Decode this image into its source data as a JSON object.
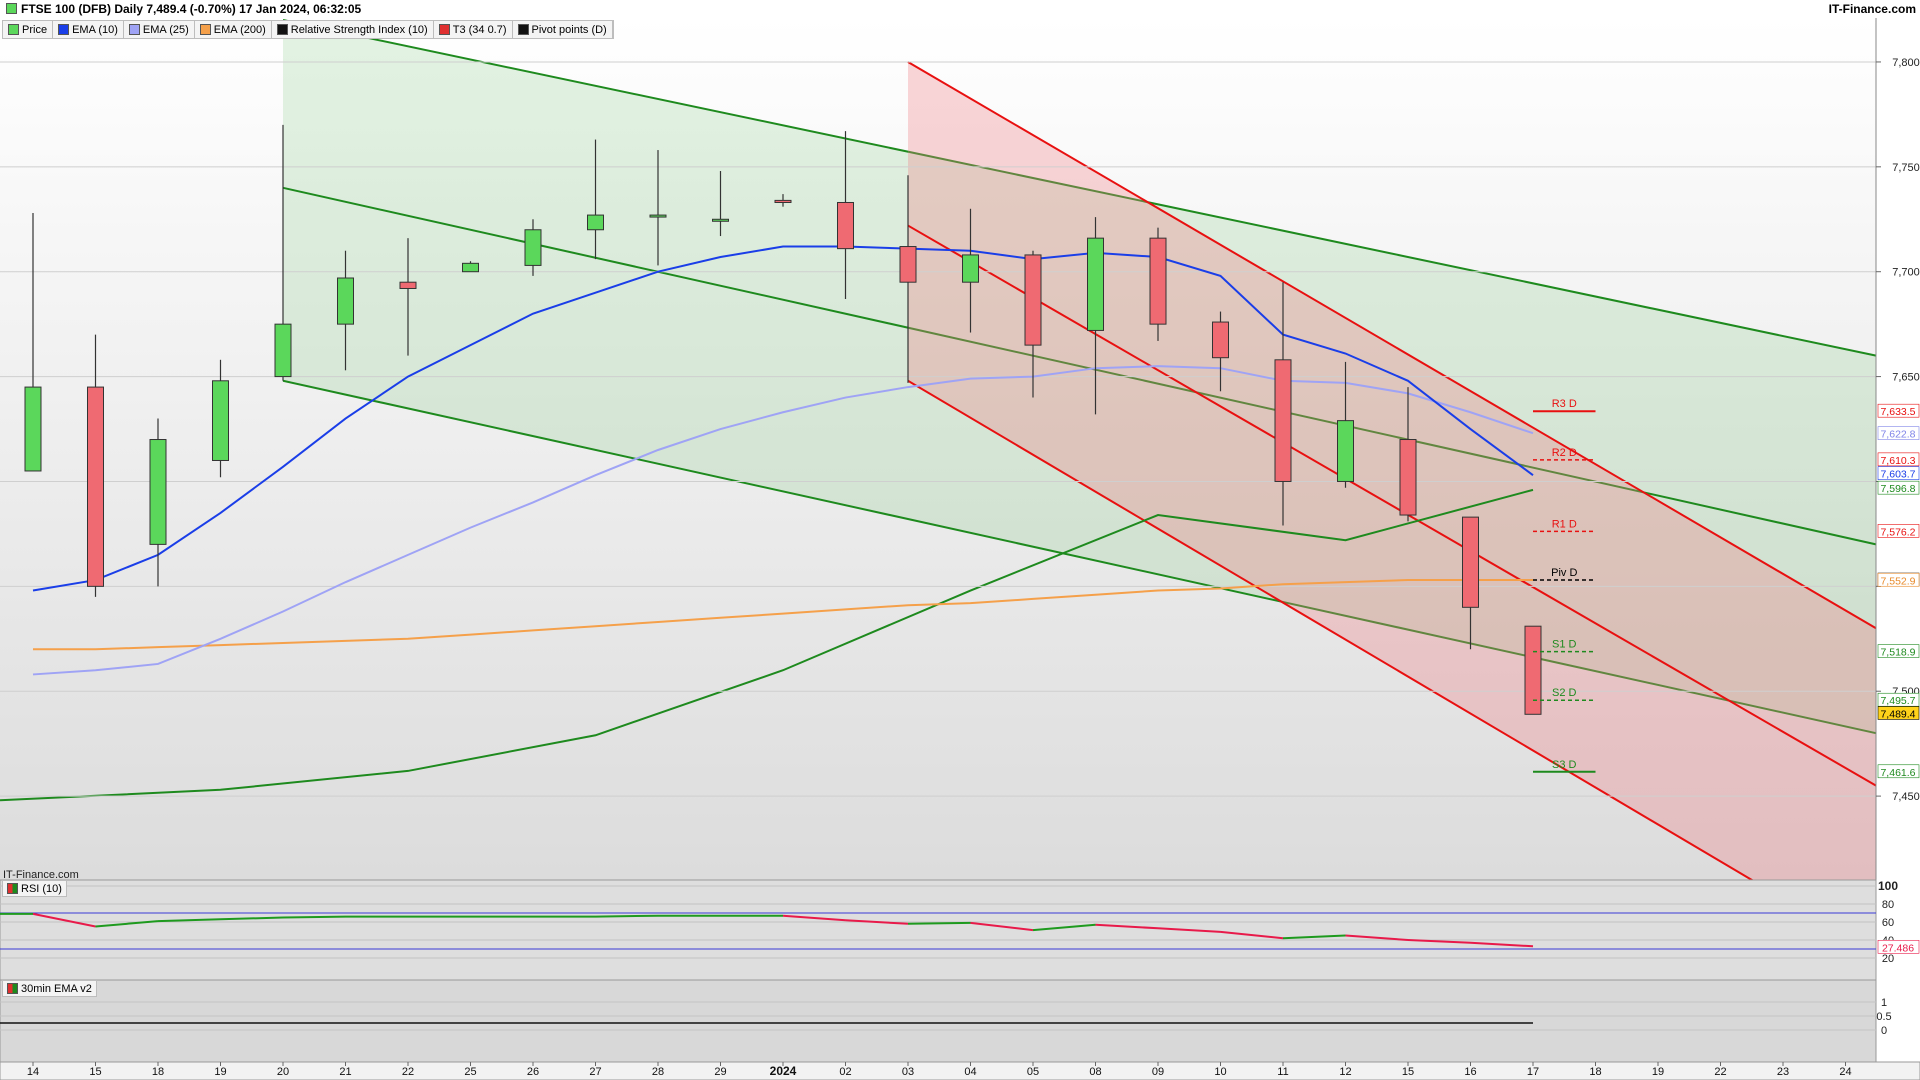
{
  "header": {
    "title": "FTSE 100 (DFB) Daily 7,489.4 (-0.70%) 17 Jan 2024, 06:32:05",
    "brand": "IT-Finance.com",
    "watermark": "IT-Finance.com"
  },
  "legend": [
    {
      "label": "Price",
      "color": "#5bd75b"
    },
    {
      "label": "EMA (10)",
      "color": "#1a3ee8"
    },
    {
      "label": "EMA (25)",
      "color": "#9fa3f5"
    },
    {
      "label": "EMA (200)",
      "color": "#f5a04a"
    },
    {
      "label": "Relative Strength Index (10)",
      "color": "#111111"
    },
    {
      "label": "T3 (34 0.7)",
      "color": "#e03030"
    },
    {
      "label": "Pivot points (D)",
      "color": "#111111"
    }
  ],
  "panels": {
    "rsi_label": "RSI (10)",
    "ema30_label": "30min EMA v2"
  },
  "colors": {
    "up": "#5bd75b",
    "down": "#ef6a72",
    "ema10": "#1a3ee8",
    "ema25": "#9fa3f5",
    "ema200": "#f5a04a",
    "green_channel": "#1e8a1e",
    "red_channel": "#e81010"
  },
  "chart_data": {
    "type": "candlestick",
    "x_labels": [
      "14",
      "15",
      "18",
      "19",
      "20",
      "21",
      "22",
      "25",
      "26",
      "27",
      "28",
      "29",
      "2024",
      "02",
      "03",
      "04",
      "05",
      "08",
      "09",
      "10",
      "11",
      "12",
      "15",
      "16",
      "17",
      "18",
      "19",
      "22",
      "23",
      "24"
    ],
    "price_axis": {
      "ylim": [
        7410,
        7820
      ],
      "ticks": [
        7450,
        7500,
        7550,
        7600,
        7650,
        7700,
        7750,
        7800
      ],
      "tick_labels": [
        "7,450",
        "7,500",
        "",
        "",
        "7,650",
        "7,700",
        "7,750",
        "7,800"
      ]
    },
    "candles": [
      {
        "o": 7605,
        "h": 7728,
        "l": 7605,
        "c": 7645
      },
      {
        "o": 7645,
        "h": 7670,
        "l": 7545,
        "c": 7550
      },
      {
        "o": 7570,
        "h": 7630,
        "l": 7550,
        "c": 7620
      },
      {
        "o": 7610,
        "h": 7658,
        "l": 7602,
        "c": 7648
      },
      {
        "o": 7650,
        "h": 7770,
        "l": 7648,
        "c": 7675
      },
      {
        "o": 7675,
        "h": 7710,
        "l": 7653,
        "c": 7697
      },
      {
        "o": 7695,
        "h": 7716,
        "l": 7660,
        "c": 7692
      },
      {
        "o": 7700,
        "h": 7705,
        "l": 7700,
        "c": 7704
      },
      {
        "o": 7703,
        "h": 7725,
        "l": 7698,
        "c": 7720
      },
      {
        "o": 7720,
        "h": 7763,
        "l": 7706,
        "c": 7727
      },
      {
        "o": 7727,
        "h": 7758,
        "l": 7703,
        "c": 7727
      },
      {
        "o": 7725,
        "h": 7748,
        "l": 7717,
        "c": 7725
      },
      {
        "o": 7734,
        "h": 7737,
        "l": 7731,
        "c": 7733
      },
      {
        "o": 7733,
        "h": 7767,
        "l": 7687,
        "c": 7711
      },
      {
        "o": 7712,
        "h": 7746,
        "l": 7647,
        "c": 7695
      },
      {
        "o": 7695,
        "h": 7730,
        "l": 7671,
        "c": 7708
      },
      {
        "o": 7708,
        "h": 7710,
        "l": 7640,
        "c": 7665
      },
      {
        "o": 7672,
        "h": 7726,
        "l": 7632,
        "c": 7716
      },
      {
        "o": 7716,
        "h": 7721,
        "l": 7667,
        "c": 7675
      },
      {
        "o": 7676,
        "h": 7681,
        "l": 7643,
        "c": 7659
      },
      {
        "o": 7658,
        "h": 7695,
        "l": 7579,
        "c": 7600
      },
      {
        "o": 7600,
        "h": 7657,
        "l": 7597,
        "c": 7629
      },
      {
        "o": 7620,
        "h": 7645,
        "l": 7581,
        "c": 7584
      },
      {
        "o": 7583,
        "h": 7583,
        "l": 7520,
        "c": 7540
      },
      {
        "o": 7531,
        "h": 7531,
        "l": 7489,
        "c": 7489
      }
    ],
    "ema10": [
      7548,
      7553,
      7565,
      7585,
      7607,
      7630,
      7650,
      7665,
      7680,
      7690,
      7700,
      7707,
      7712,
      7712,
      7711,
      7710,
      7706,
      7709,
      7707,
      7698,
      7670,
      7661,
      7648,
      7625,
      7603
    ],
    "ema25": [
      7508,
      7510,
      7513,
      7525,
      7538,
      7552,
      7565,
      7578,
      7590,
      7603,
      7615,
      7625,
      7633,
      7640,
      7645,
      7649,
      7650,
      7654,
      7655,
      7654,
      7648,
      7647,
      7642,
      7633,
      7623
    ],
    "ema200": [
      7520,
      7520,
      7521,
      7522,
      7523,
      7524,
      7525,
      7527,
      7529,
      7531,
      7533,
      7535,
      7537,
      7539,
      7541,
      7542,
      7544,
      7546,
      7548,
      7549,
      7551,
      7552,
      7553,
      7553,
      7553
    ],
    "pivots": [
      {
        "label": "R3 D",
        "value": 7633.5,
        "color": "#e81010",
        "style": "solid"
      },
      {
        "label": "R2 D",
        "value": 7610.3,
        "color": "#e81010",
        "style": "dashed"
      },
      {
        "label": "R1 D",
        "value": 7576.2,
        "color": "#e81010",
        "style": "dashed"
      },
      {
        "label": "Piv D",
        "value": 7553.0,
        "color": "#000000",
        "style": "dashed"
      },
      {
        "label": "S1 D",
        "value": 7518.9,
        "color": "#1e8a1e",
        "style": "dashed"
      },
      {
        "label": "S2 D",
        "value": 7495.7,
        "color": "#1e8a1e",
        "style": "dashed"
      },
      {
        "label": "S3 D",
        "value": 7461.6,
        "color": "#1e8a1e",
        "style": "solid"
      }
    ],
    "axis_tags": [
      {
        "text": "7,633.5",
        "value": 7633.5,
        "fg": "#e81010",
        "bg": "#ffffff"
      },
      {
        "text": "7,622.8",
        "value": 7622.8,
        "fg": "#7f84e8",
        "bg": "#ffffff"
      },
      {
        "text": "7,610.3",
        "value": 7610.3,
        "fg": "#e81010",
        "bg": "#ffffff"
      },
      {
        "text": "7,603.7",
        "value": 7603.7,
        "fg": "#1a3ee8",
        "bg": "#ffffff"
      },
      {
        "text": "7,596.8",
        "value": 7596.8,
        "fg": "#1e8a1e",
        "bg": "#ffffff"
      },
      {
        "text": "7,576.2",
        "value": 7576.2,
        "fg": "#e81010",
        "bg": "#ffffff"
      },
      {
        "text": "7,553.0",
        "value": 7553.0,
        "fg": "#000000",
        "bg": "#ffffff"
      },
      {
        "text": "7,552.9",
        "value": 7552.9,
        "fg": "#e88a2a",
        "bg": "#ffffff"
      },
      {
        "text": "7,518.9",
        "value": 7518.9,
        "fg": "#1e8a1e",
        "bg": "#ffffff"
      },
      {
        "text": "7,495.7",
        "value": 7495.7,
        "fg": "#1e8a1e",
        "bg": "#ffffff"
      },
      {
        "text": "7,489.4",
        "value": 7489.4,
        "fg": "#000000",
        "bg": "#ffd21a"
      },
      {
        "text": "7,461.6",
        "value": 7461.6,
        "fg": "#1e8a1e",
        "bg": "#ffffff"
      }
    ],
    "channels": {
      "green": {
        "start_index": 4,
        "end_index": 29.5,
        "upper": [
          7820,
          7660
        ],
        "mid": [
          7740,
          7570
        ],
        "lower": [
          7648,
          7480
        ]
      },
      "red": {
        "start_index": 14,
        "end_index": 29.5,
        "upper": [
          7800,
          7530
        ],
        "mid": [
          7722,
          7455
        ],
        "lower": [
          7648,
          7375
        ]
      },
      "t3_curve": [
        {
          "i": 0,
          "v": 7448
        },
        {
          "i": 3,
          "v": 7453
        },
        {
          "i": 6,
          "v": 7462
        },
        {
          "i": 9,
          "v": 7479
        },
        {
          "i": 12,
          "v": 7510
        },
        {
          "i": 15,
          "v": 7548
        },
        {
          "i": 18,
          "v": 7584
        },
        {
          "i": 21,
          "v": 7572
        },
        {
          "i": 24,
          "v": 7596
        }
      ]
    },
    "rsi": {
      "ylim": [
        0,
        100
      ],
      "ticks": [
        100,
        80,
        60,
        40,
        20
      ],
      "tick_labels": [
        "100",
        "80",
        "60",
        "40",
        "20"
      ],
      "levels": [
        70,
        30
      ],
      "values": [
        69,
        55,
        61,
        63,
        65,
        66,
        66,
        66,
        66,
        66,
        67,
        67,
        67,
        62,
        58,
        59,
        51,
        57,
        53,
        49,
        42,
        45,
        40,
        37,
        33
      ],
      "last_label": "27.486"
    },
    "ema30": {
      "ticks": [
        1,
        0.5,
        0
      ],
      "tick_labels": [
        "1",
        "0.5",
        "0"
      ],
      "line_value": 0
    }
  }
}
